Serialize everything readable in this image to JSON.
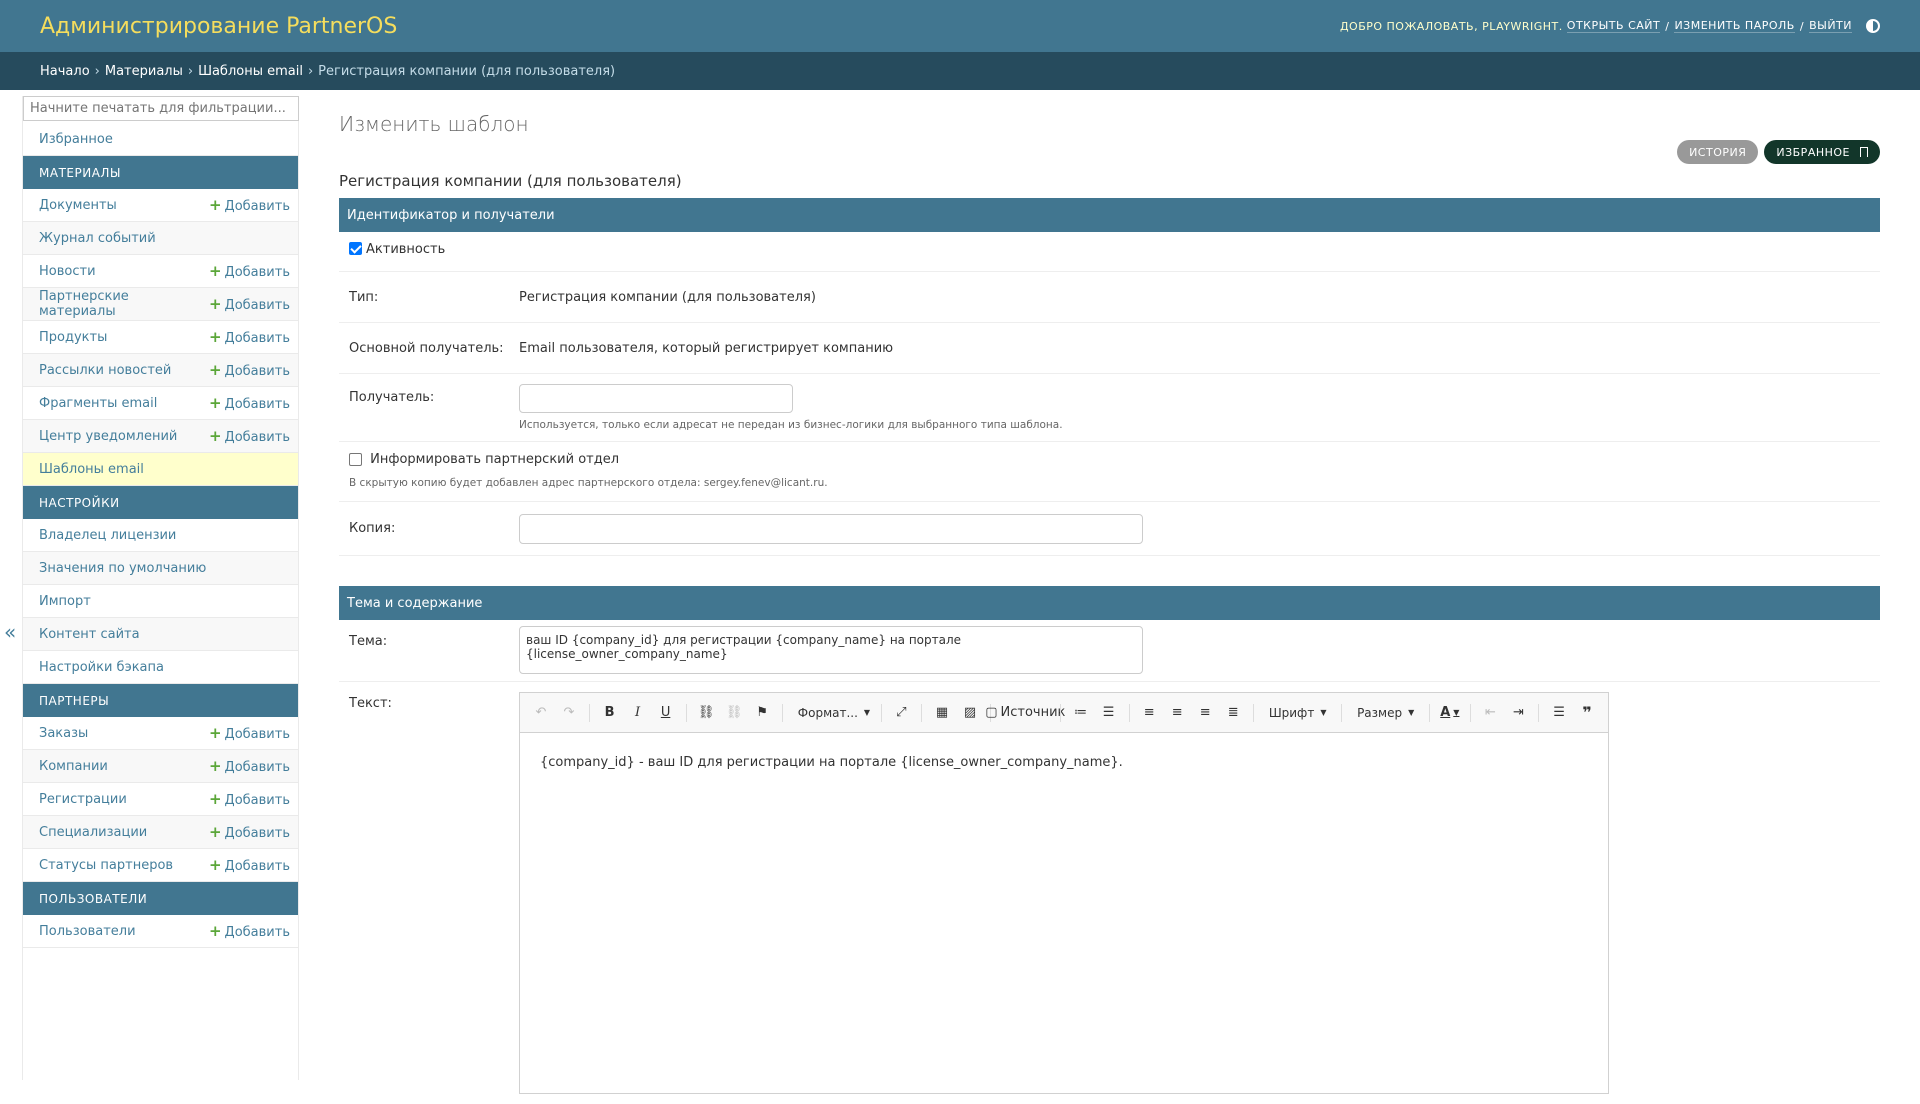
{
  "header": {
    "branding": "Администрирование PartnerOS",
    "welcome": "Добро пожаловать,",
    "username": "playwright",
    "open_site": "Открыть сайт",
    "change_password": "Изменить пароль",
    "logout": "Выйти"
  },
  "breadcrumbs": [
    "Начало",
    "Материалы",
    "Шаблоны email",
    "Регистрация компании (для пользователя)"
  ],
  "sidebar": {
    "filter_placeholder": "Начните печатать для фильтрации...",
    "favorites": "Избранное",
    "add_label": "Добавить",
    "sections": [
      {
        "title": "Материалы",
        "items": [
          {
            "label": "Документы",
            "add": true
          },
          {
            "label": "Журнал событий",
            "add": false
          },
          {
            "label": "Новости",
            "add": true
          },
          {
            "label": "Партнерские материалы",
            "add": true
          },
          {
            "label": "Продукты",
            "add": true
          },
          {
            "label": "Рассылки новостей",
            "add": true
          },
          {
            "label": "Фрагменты email",
            "add": true
          },
          {
            "label": "Центр уведомлений",
            "add": true
          },
          {
            "label": "Шаблоны email",
            "add": false,
            "active": true
          }
        ]
      },
      {
        "title": "Настройки",
        "items": [
          {
            "label": "Владелец лицензии",
            "add": false
          },
          {
            "label": "Значения по умолчанию",
            "add": false
          },
          {
            "label": "Импорт",
            "add": false
          },
          {
            "label": "Контент сайта",
            "add": false
          },
          {
            "label": "Настройки бэкапа",
            "add": false
          }
        ]
      },
      {
        "title": "Партнеры",
        "items": [
          {
            "label": "Заказы",
            "add": true
          },
          {
            "label": "Компании",
            "add": true
          },
          {
            "label": "Регистрации",
            "add": true
          },
          {
            "label": "Специализации",
            "add": true
          },
          {
            "label": "Статусы партнеров",
            "add": true
          }
        ]
      },
      {
        "title": "Пользователи",
        "items": [
          {
            "label": "Пользователи",
            "add": true
          }
        ]
      }
    ]
  },
  "content": {
    "page_title": "Изменить шаблон",
    "object_name": "Регистрация компании (для пользователя)",
    "history_button": "История",
    "favorite_button": "Избранное",
    "fieldset1": {
      "title": "Идентификатор и получатели",
      "active_label": "Активность",
      "active_checked": true,
      "type_label": "Тип:",
      "type_value": "Регистрация компании (для пользователя)",
      "main_recipient_label": "Основной получатель:",
      "main_recipient_value": "Email пользователя, который регистрирует компанию",
      "recipient_label": "Получатель:",
      "recipient_value": "",
      "recipient_help": "Используется, только если адресат не передан из бизнес-логики для выбранного типа шаблона.",
      "inform_label": "Информировать партнерский отдел",
      "inform_checked": false,
      "inform_help": "В скрытую копию будет добавлен адрес партнерского отдела: sergey.fenev@licant.ru.",
      "copy_label": "Копия:",
      "copy_value": ""
    },
    "fieldset2": {
      "title": "Тема и содержание",
      "subject_label": "Тема:",
      "subject_value": "ваш ID {company_id} для регистрации {company_name} на портале {license_owner_company_name}",
      "text_label": "Текст:",
      "text_value": "{company_id} - ваш ID для регистрации на портале {license_owner_company_name}.",
      "toolbar": {
        "format": "Формат...",
        "source": "Источник",
        "font": "Шрифт",
        "size": "Размер"
      }
    }
  }
}
